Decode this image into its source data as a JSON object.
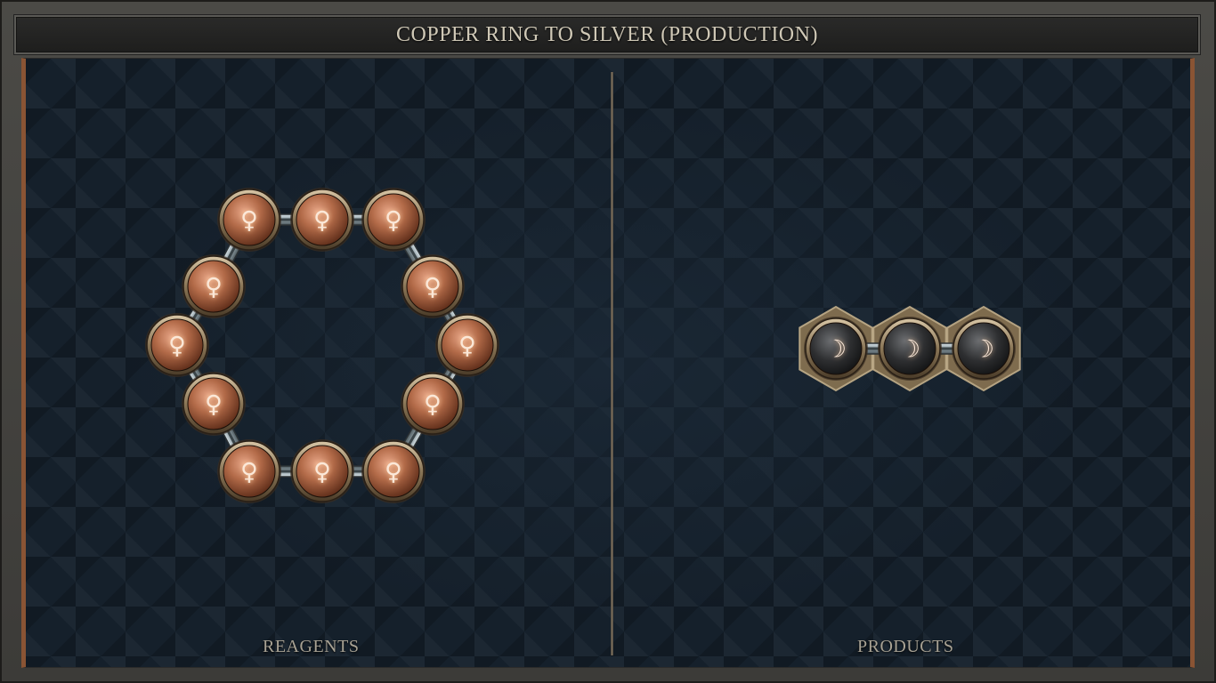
{
  "title": "COPPER RING TO SILVER (PRODUCTION)",
  "sections": {
    "reagents_label": "REAGENTS",
    "products_label": "PRODUCTS"
  },
  "reagents": {
    "element": "copper",
    "symbol": "♀",
    "count": 12,
    "shape": "hexagonal ring"
  },
  "products": {
    "element": "silver",
    "symbol": "☽",
    "count": 3,
    "shape": "linear chain"
  },
  "colors": {
    "copper_atom": "#b26a48",
    "silver_atom": "#2e2f31",
    "bond": "#9aa8ad",
    "frame_accent": "#8a5434",
    "background": "#15202b"
  }
}
